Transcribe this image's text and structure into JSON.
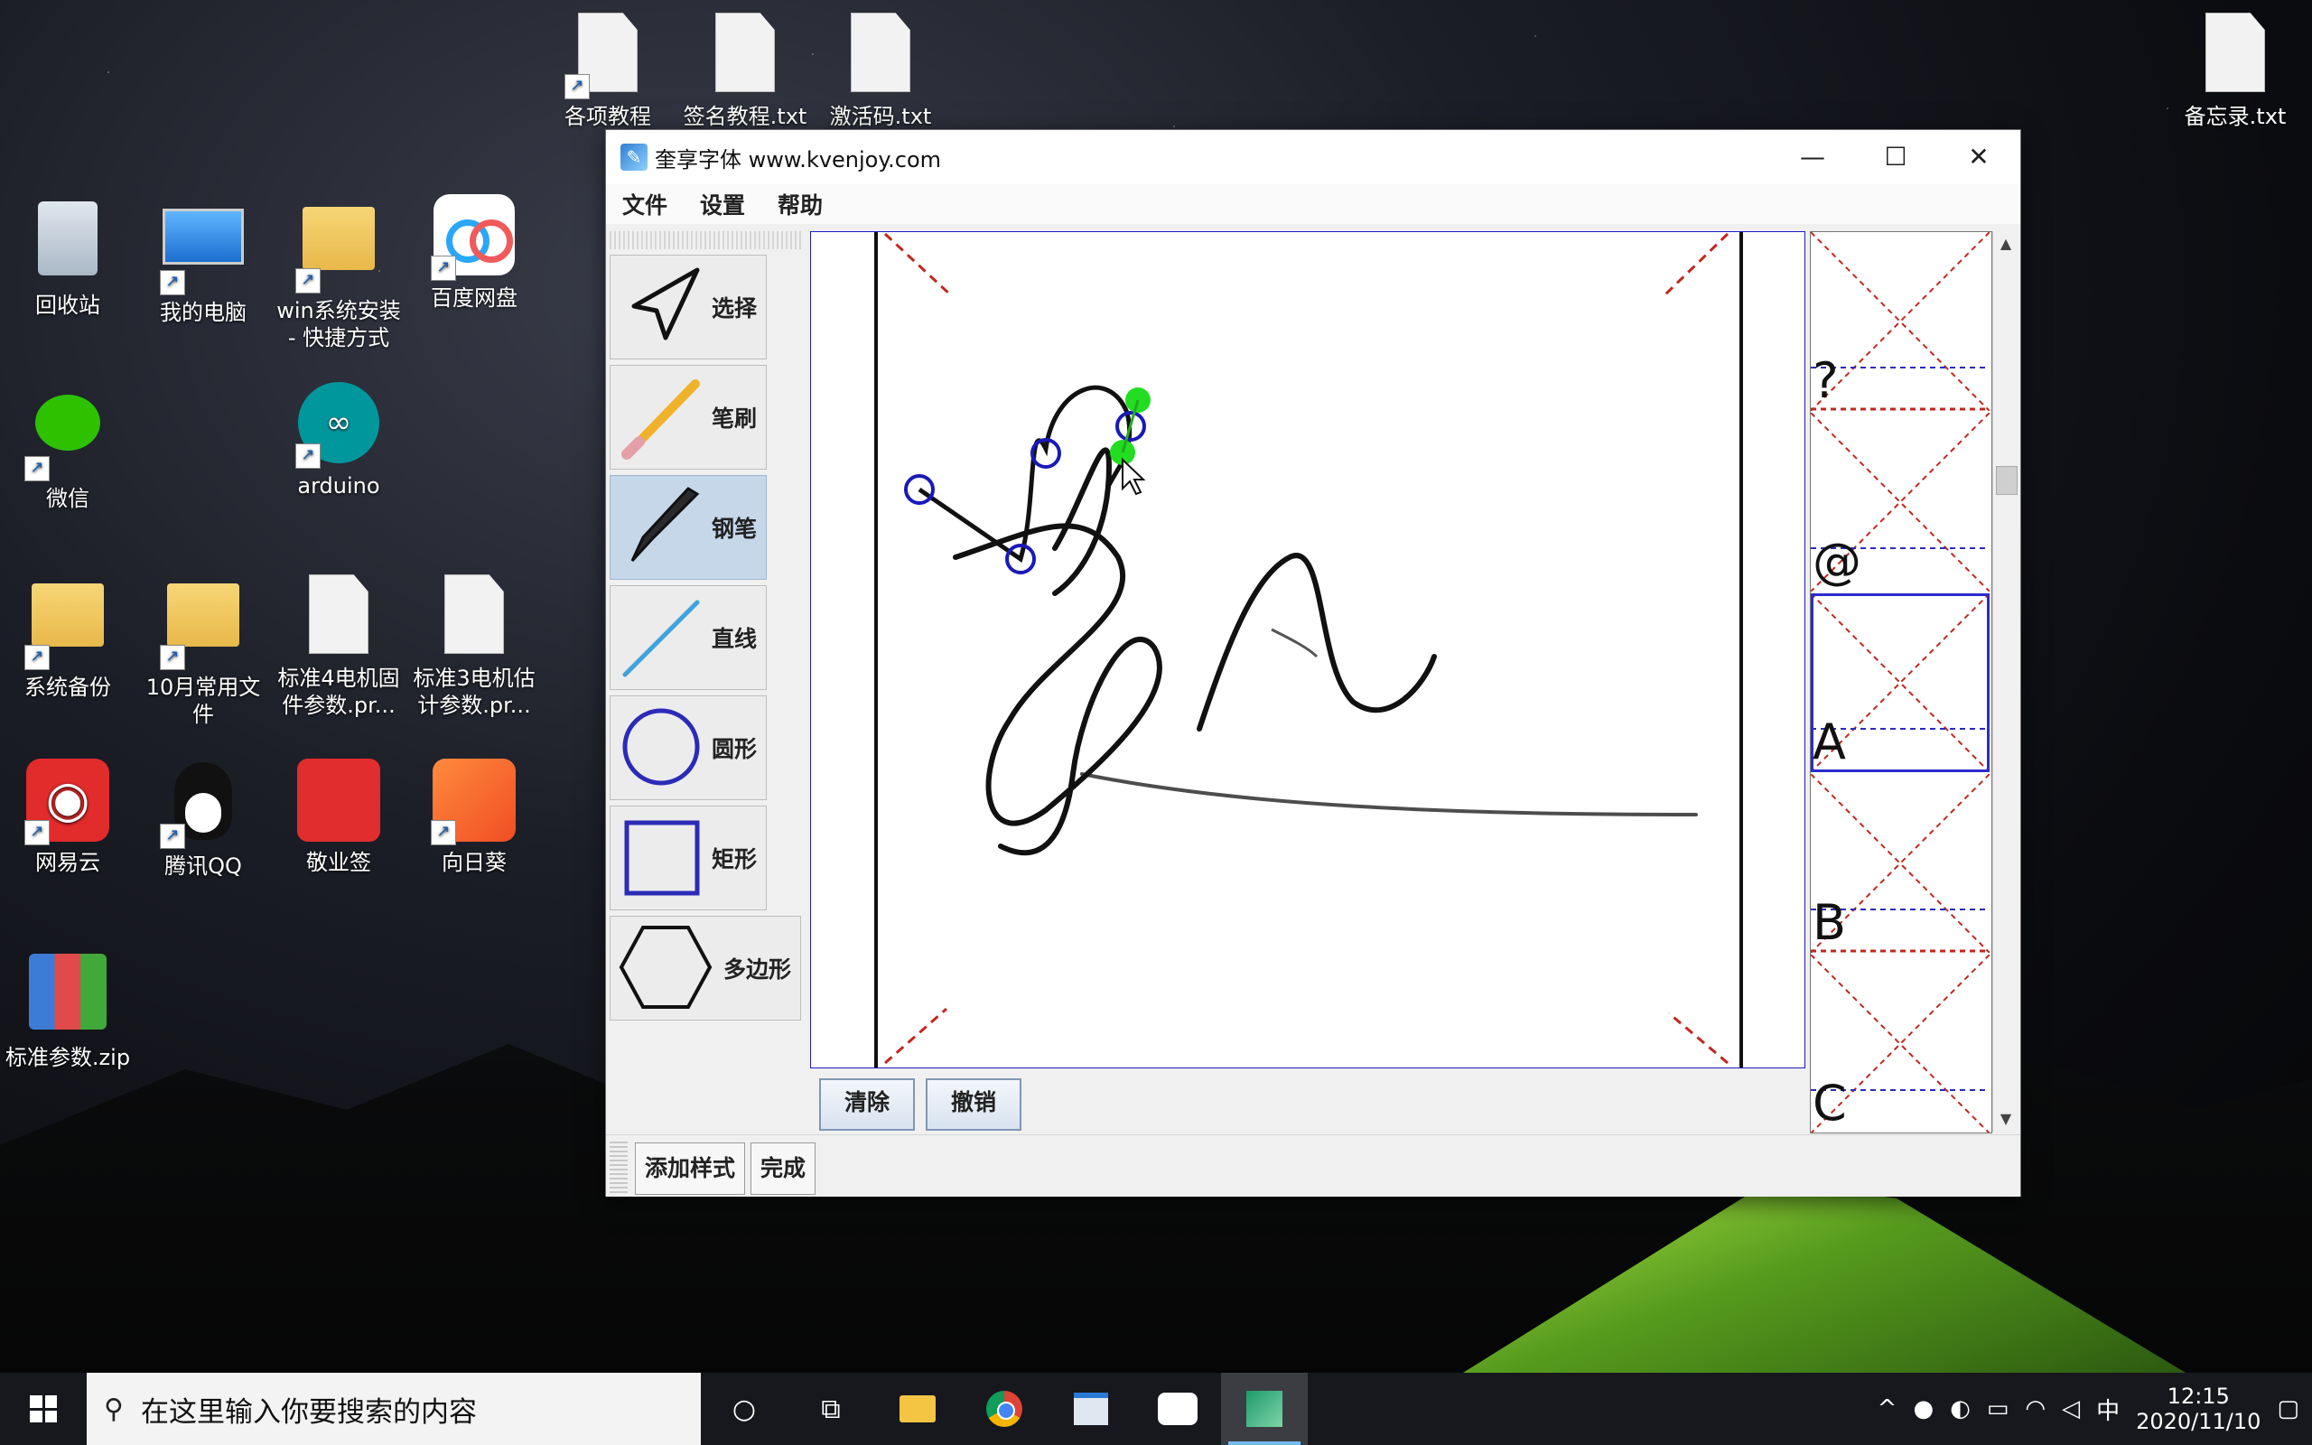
{
  "desktop": {
    "icons": {
      "tutorials": "各项教程",
      "sign_tutorial": "签名教程.txt",
      "activation_code": "激活码.txt",
      "memo": "备忘录.txt",
      "recycle_bin": "回收站",
      "my_computer": "我的电脑",
      "win_install": "win系统安装 - 快捷方式",
      "baidu_pan": "百度网盘",
      "wechat": "微信",
      "arduino": "arduino",
      "backup": "系统备份",
      "oct_files": "10月常用文件",
      "motor4": "标准4电机固件参数.pr...",
      "motor3": "标准3电机估计参数.pr...",
      "netease": "网易云",
      "qq": "腾讯QQ",
      "jingyeqian": "敬业签",
      "sunflower": "向日葵",
      "zip": "标准参数.zip"
    }
  },
  "window": {
    "title": "奎享字体 www.kvenjoy.com",
    "menu": {
      "file": "文件",
      "settings": "设置",
      "help": "帮助"
    },
    "tools": {
      "select": "选择",
      "brush": "笔刷",
      "pen": "钢笔",
      "line": "直线",
      "circle": "圆形",
      "rect": "矩形",
      "polygon": "多边形"
    },
    "canvas_buttons": {
      "clear": "清除",
      "undo": "撤销"
    },
    "bottom_buttons": {
      "add_style": "添加样式",
      "done": "完成"
    },
    "glyphs": [
      "?",
      "@",
      "A",
      "B",
      "C"
    ]
  },
  "taskbar": {
    "search_placeholder": "在这里输入你要搜索的内容",
    "time": "12:15",
    "date": "2020/11/10",
    "ime": "中"
  },
  "colors": {
    "canvas_border": "#1c1cc4",
    "guide_red": "#c0281e",
    "pen_node": "#1a1ab8",
    "active_node": "#22dd22",
    "taskbar": "#16181d"
  }
}
